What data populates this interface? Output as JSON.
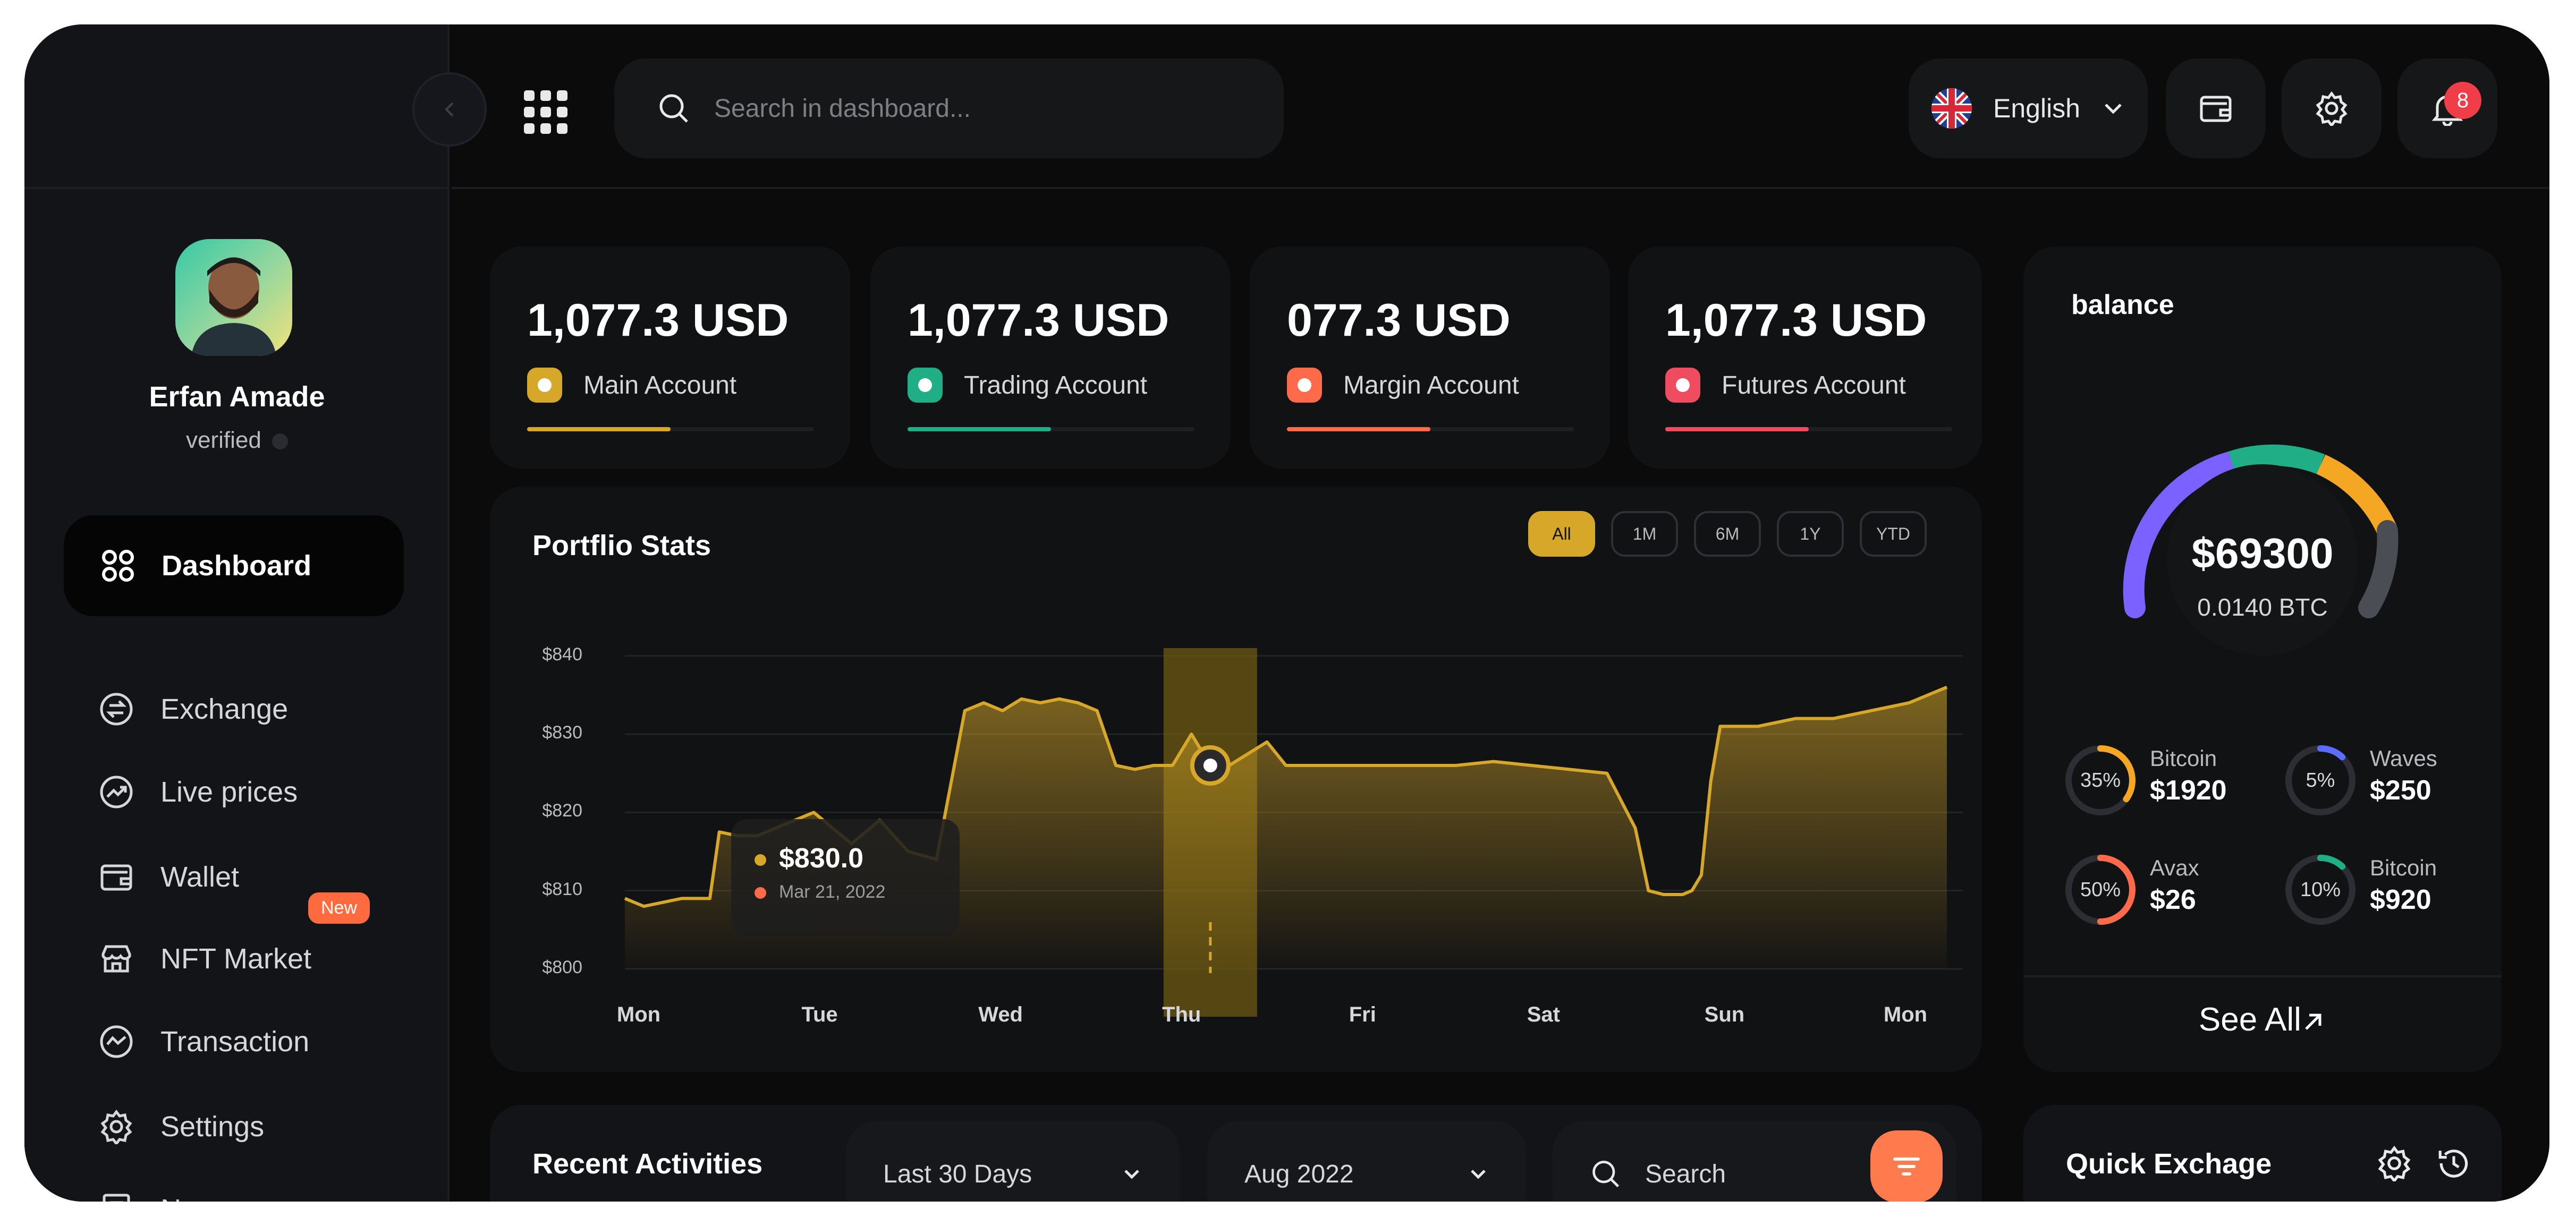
{
  "search": {
    "placeholder": "Search in dashboard..."
  },
  "header": {
    "language": "English",
    "notifications": "8"
  },
  "user": {
    "name": "Erfan Amade",
    "status": "verified"
  },
  "nav": {
    "active": "Dashboard",
    "items": [
      "Exchange",
      "Live prices",
      "Wallet",
      "NFT Market",
      "Transaction",
      "Settings",
      "News"
    ],
    "new_badge": "New"
  },
  "accounts": [
    {
      "amount": "1,077.3 USD",
      "label": "Main Account",
      "color": "#d6a728",
      "progress": 0.5
    },
    {
      "amount": "1,077.3 USD",
      "label": "Trading Account",
      "color": "#1fae86",
      "progress": 0.5
    },
    {
      "amount": "077.3 USD",
      "label": "Margin Account",
      "color": "#ff6b4a",
      "progress": 0.5
    },
    {
      "amount": "1,077.3 USD",
      "label": "Futures Account",
      "color": "#ef4d5f",
      "progress": 0.5
    }
  ],
  "portfolio": {
    "title": "Portflio Stats",
    "ranges": [
      "All",
      "1M",
      "6M",
      "1Y",
      "YTD"
    ],
    "active_range": "All",
    "tooltip": {
      "value": "$830.0",
      "date": "Mar 21, 2022"
    }
  },
  "chart_data": {
    "type": "area",
    "title": "Portflio Stats",
    "categories": [
      "Mon",
      "Tue",
      "Wed",
      "Thu",
      "Fri",
      "Sat",
      "Sun",
      "Mon"
    ],
    "yticks": [
      "$840",
      "$830",
      "$820",
      "$810",
      "$800"
    ],
    "ylim": [
      800,
      841
    ],
    "grid": true,
    "color": "#d6a728",
    "x": [
      0,
      0.1,
      0.2,
      0.3,
      0.45,
      0.5,
      0.6,
      0.7,
      0.8,
      0.9,
      1.0,
      1.2,
      1.35,
      1.5,
      1.65,
      1.8,
      1.9,
      2.0,
      2.1,
      2.2,
      2.3,
      2.4,
      2.5,
      2.6,
      2.7,
      2.8,
      2.9,
      3.0,
      3.1,
      3.2,
      3.4,
      3.5,
      3.6,
      3.7,
      3.8,
      3.9,
      4.0,
      4.1,
      4.2,
      4.4,
      4.6,
      4.8,
      5.0,
      5.2,
      5.35,
      5.42,
      5.5,
      5.6,
      5.65,
      5.7,
      5.75,
      5.8,
      6.0,
      6.2,
      6.4,
      6.6,
      6.8,
      7.0
    ],
    "y": [
      809,
      808,
      808.5,
      809,
      809,
      817.5,
      817,
      817,
      818,
      819,
      820,
      816,
      819,
      815,
      814,
      833,
      834,
      833,
      834.5,
      834,
      834.5,
      834,
      833,
      826,
      825.5,
      826,
      826,
      830,
      826,
      826,
      829,
      826,
      826,
      826,
      826,
      826,
      826,
      826,
      826,
      826,
      826.5,
      826,
      825.5,
      825,
      818,
      810,
      809.5,
      809.5,
      810,
      812,
      824,
      831,
      831,
      832,
      832,
      833,
      834,
      836
    ]
  },
  "balance": {
    "title": "balance",
    "amount": "$69300",
    "btc": "0.0140 BTC",
    "see_all": "See All",
    "gauge_colors": [
      "#7b61ff",
      "#1fae86",
      "#f5a623",
      "#4b4d55"
    ],
    "coins": [
      {
        "name": "Bitcoin",
        "value": "$1920",
        "percent": "35%",
        "color": "#f5a623"
      },
      {
        "name": "Waves",
        "value": "$250",
        "percent": "5%",
        "color": "#5b6cff"
      },
      {
        "name": "Avax",
        "value": "$26",
        "percent": "50%",
        "color": "#ff6b4a"
      },
      {
        "name": "Bitcoin",
        "value": "$920",
        "percent": "10%",
        "color": "#1fae86"
      }
    ]
  },
  "activities": {
    "title": "Recent Activities",
    "period": "Last 30 Days",
    "month": "Aug 2022",
    "search_placeholder": "Search"
  },
  "quick_exchange": {
    "title": "Quick Exchage"
  }
}
